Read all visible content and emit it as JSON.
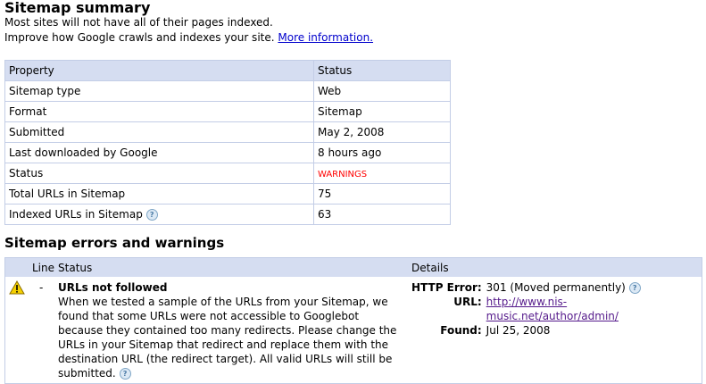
{
  "summary": {
    "title": "Sitemap summary",
    "line1": "Most sites will not have all of their pages indexed.",
    "line2": "Improve how Google crawls and indexes your site.",
    "link": "More information."
  },
  "props": {
    "headers": [
      "Property",
      "Status"
    ],
    "rows": [
      {
        "k": "Sitemap type",
        "v": "Web"
      },
      {
        "k": "Format",
        "v": "Sitemap"
      },
      {
        "k": "Submitted",
        "v": "May 2, 2008"
      },
      {
        "k": "Last downloaded by Google",
        "v": "8 hours ago"
      },
      {
        "k": "Status",
        "v": "WARNINGS"
      },
      {
        "k": "Total URLs in Sitemap",
        "v": "75"
      },
      {
        "k": "Indexed URLs in Sitemap",
        "v": "63"
      }
    ]
  },
  "errors": {
    "title": "Sitemap errors and warnings",
    "headers": {
      "line": "Line",
      "status": "Status",
      "details": "Details"
    },
    "row": {
      "line": "-",
      "title": "URLs not followed",
      "desc": "When we tested a sample of the URLs from your Sitemap, we found that some URLs were not accessible to Googlebot because they contained too many redirects. Please change the URLs in your Sitemap that redirect and replace them with the destination URL (the redirect target). All valid URLs will still be submitted.",
      "http_label": "HTTP Error:",
      "http": "301 (Moved permanently)",
      "url_label": "URL:",
      "url": "http://www.nis-music.net/author/admin/",
      "found_label": "Found:",
      "found": "Jul 25, 2008"
    }
  },
  "help_glyph": "?"
}
